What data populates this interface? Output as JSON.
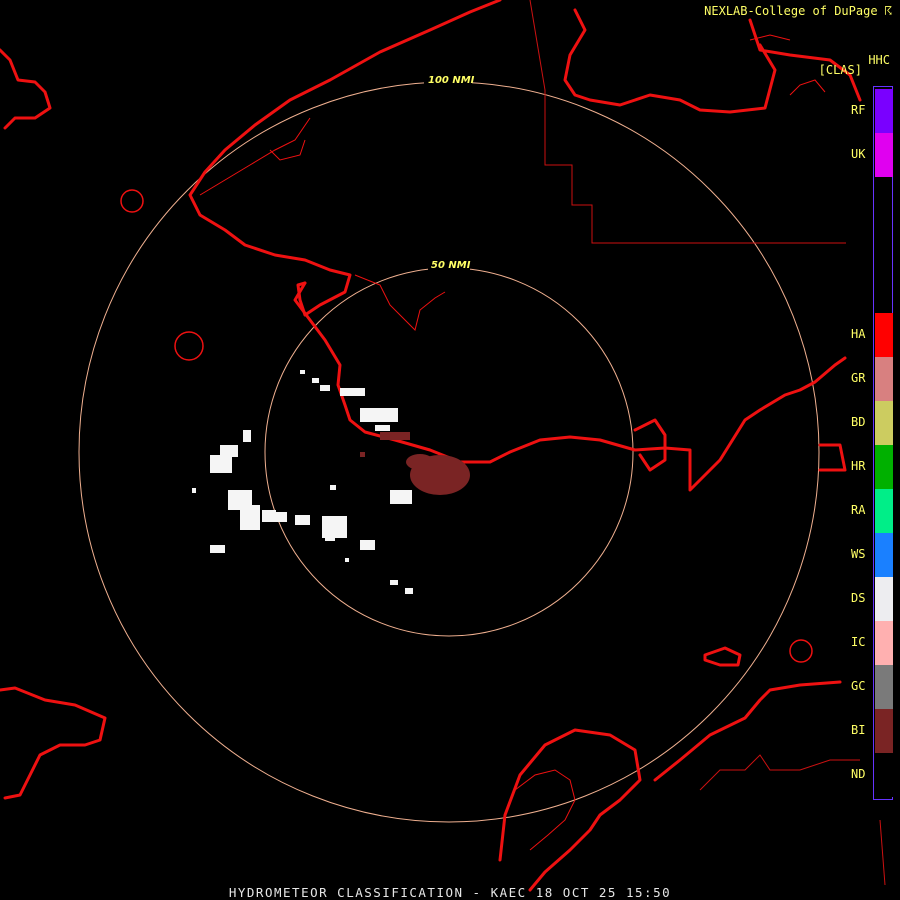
{
  "header": {
    "credit": "NEXLAB-College of DuPage ☈"
  },
  "product": {
    "code": "HHC",
    "class_label": "[CLAS]"
  },
  "footer": {
    "title": "HYDROMETEOR CLASSIFICATION - KAEC 18 OCT 25 15:50"
  },
  "range_rings": [
    {
      "label": "50 NMI"
    },
    {
      "label": "100 NMI"
    }
  ],
  "legend": [
    {
      "code": "RF",
      "color": "#7a00ff"
    },
    {
      "code": "UK",
      "color": "#e000f0"
    },
    {
      "code": "HA",
      "color": "#ff0000"
    },
    {
      "code": "GR",
      "color": "#d88080"
    },
    {
      "code": "BD",
      "color": "#cccc60"
    },
    {
      "code": "HR",
      "color": "#00b000"
    },
    {
      "code": "RA",
      "color": "#00ee88"
    },
    {
      "code": "WS",
      "color": "#1a80ff"
    },
    {
      "code": "DS",
      "color": "#ededf0"
    },
    {
      "code": "IC",
      "color": "#ffb0b0"
    },
    {
      "code": "GC",
      "color": "#7a7a7a"
    },
    {
      "code": "BI",
      "color": "#7a2424"
    },
    {
      "code": "ND",
      "color": "#000000"
    }
  ],
  "colors": {
    "coastline": "#ee1111",
    "ring": "#f0b090",
    "text": "#ffff66"
  }
}
